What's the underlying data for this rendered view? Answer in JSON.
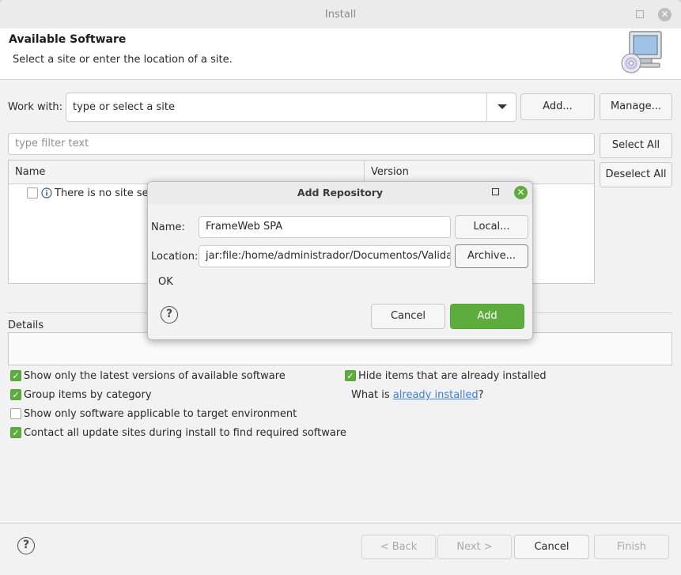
{
  "window": {
    "title": "Install"
  },
  "header": {
    "title": "Available Software",
    "subtitle": "Select a site or enter the location of a site."
  },
  "work_with": {
    "label": "Work with:",
    "value": "type or select a site",
    "add_label": "Add...",
    "manage_label": "Manage..."
  },
  "filter": {
    "placeholder": "type filter text",
    "select_all_label": "Select All",
    "deselect_all_label": "Deselect All"
  },
  "table": {
    "columns": [
      "Name",
      "Version"
    ],
    "rows": [
      {
        "text": "There is no site sele"
      }
    ]
  },
  "details": {
    "label": "Details"
  },
  "options": {
    "latest_versions": {
      "label": "Show only the latest versions of available software",
      "checked": true
    },
    "group_by_category": {
      "label": "Group items by category",
      "checked": true
    },
    "applicable_only": {
      "label": "Show only software applicable to target environment",
      "checked": false
    },
    "contact_sites": {
      "label": "Contact all update sites during install to find required software",
      "checked": true
    },
    "hide_installed": {
      "label": "Hide items that are already installed",
      "checked": true
    },
    "what_is_prefix": "What is ",
    "what_is_link": "already installed",
    "what_is_suffix": "?"
  },
  "footer": {
    "back_label": "< Back",
    "next_label": "Next >",
    "cancel_label": "Cancel",
    "finish_label": "Finish"
  },
  "dialog": {
    "title": "Add Repository",
    "name_label": "Name:",
    "name_value": "FrameWeb SPA",
    "local_label": "Local...",
    "location_label": "Location:",
    "location_value": "jar:file:/home/administrador/Documentos/Validaç",
    "archive_label": "Archive...",
    "status": "OK",
    "cancel_label": "Cancel",
    "add_label": "Add"
  },
  "colors": {
    "accent": "#5eac3e",
    "link": "#3c7fd6"
  }
}
